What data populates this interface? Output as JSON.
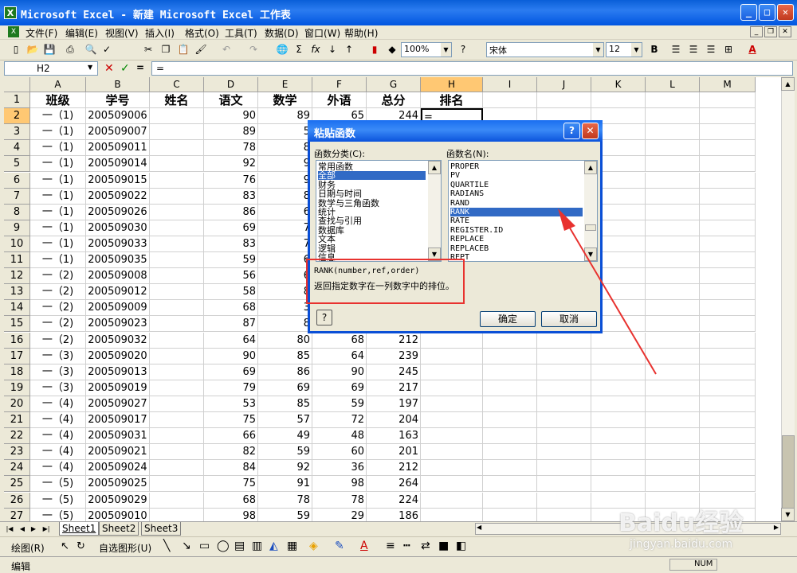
{
  "window": {
    "title": "Microsoft Excel - 新建 Microsoft Excel 工作表"
  },
  "menu": [
    "文件(F)",
    "编辑(E)",
    "视图(V)",
    "插入(I)",
    "格式(O)",
    "工具(T)",
    "数据(D)",
    "窗口(W)",
    "帮助(H)"
  ],
  "toolbar": {
    "zoom": "100%",
    "font": "宋体",
    "size": "12",
    "bold": "B",
    "font_color": "A"
  },
  "formula_bar": {
    "cell_ref": "H2",
    "eq": "=",
    "content": "="
  },
  "grid": {
    "columns": [
      "A",
      "B",
      "C",
      "D",
      "E",
      "F",
      "G",
      "H",
      "I",
      "J",
      "K",
      "L",
      "M"
    ],
    "header_row": [
      "班级",
      "学号",
      "姓名",
      "语文",
      "数学",
      "外语",
      "总分",
      "排名"
    ],
    "rows": [
      {
        "n": "1"
      },
      {
        "n": "2",
        "a": "一（1)",
        "b": "200509006",
        "d": "90",
        "e": "89",
        "f": "65",
        "g": "244",
        "h": "="
      },
      {
        "n": "3",
        "a": "一（1)",
        "b": "200509007",
        "d": "89",
        "e": "5"
      },
      {
        "n": "4",
        "a": "一（1)",
        "b": "200509011",
        "d": "78",
        "e": "8"
      },
      {
        "n": "5",
        "a": "一（1)",
        "b": "200509014",
        "d": "92",
        "e": "9"
      },
      {
        "n": "6",
        "a": "一（1)",
        "b": "200509015",
        "d": "76",
        "e": "9"
      },
      {
        "n": "7",
        "a": "一（1)",
        "b": "200509022",
        "d": "83",
        "e": "8"
      },
      {
        "n": "8",
        "a": "一（1)",
        "b": "200509026",
        "d": "86",
        "e": "6"
      },
      {
        "n": "9",
        "a": "一（1)",
        "b": "200509030",
        "d": "69",
        "e": "7"
      },
      {
        "n": "10",
        "a": "一（1)",
        "b": "200509033",
        "d": "83",
        "e": "7"
      },
      {
        "n": "11",
        "a": "一（1)",
        "b": "200509035",
        "d": "59",
        "e": "6"
      },
      {
        "n": "12",
        "a": "一（2)",
        "b": "200509008",
        "d": "56",
        "e": "6"
      },
      {
        "n": "13",
        "a": "一（2)",
        "b": "200509012",
        "d": "58",
        "e": "8"
      },
      {
        "n": "14",
        "a": "一（2)",
        "b": "200509009",
        "d": "68",
        "e": "3"
      },
      {
        "n": "15",
        "a": "一（2)",
        "b": "200509023",
        "d": "87",
        "e": "8"
      },
      {
        "n": "16",
        "a": "一（2)",
        "b": "200509032",
        "d": "64",
        "e": "80",
        "f": "68",
        "g": "212"
      },
      {
        "n": "17",
        "a": "一（3)",
        "b": "200509020",
        "d": "90",
        "e": "85",
        "f": "64",
        "g": "239"
      },
      {
        "n": "18",
        "a": "一（3)",
        "b": "200509013",
        "d": "69",
        "e": "86",
        "f": "90",
        "g": "245"
      },
      {
        "n": "19",
        "a": "一（3)",
        "b": "200509019",
        "d": "79",
        "e": "69",
        "f": "69",
        "g": "217"
      },
      {
        "n": "20",
        "a": "一（4)",
        "b": "200509027",
        "d": "53",
        "e": "85",
        "f": "59",
        "g": "197"
      },
      {
        "n": "21",
        "a": "一（4)",
        "b": "200509017",
        "d": "75",
        "e": "57",
        "f": "72",
        "g": "204"
      },
      {
        "n": "22",
        "a": "一（4)",
        "b": "200509031",
        "d": "66",
        "e": "49",
        "f": "48",
        "g": "163"
      },
      {
        "n": "23",
        "a": "一（4)",
        "b": "200509021",
        "d": "82",
        "e": "59",
        "f": "60",
        "g": "201"
      },
      {
        "n": "24",
        "a": "一（4)",
        "b": "200509024",
        "d": "84",
        "e": "92",
        "f": "36",
        "g": "212"
      },
      {
        "n": "25",
        "a": "一（5)",
        "b": "200509025",
        "d": "75",
        "e": "91",
        "f": "98",
        "g": "264"
      },
      {
        "n": "26",
        "a": "一（5)",
        "b": "200509029",
        "d": "68",
        "e": "78",
        "f": "78",
        "g": "224"
      },
      {
        "n": "27",
        "a": "一（5)",
        "b": "200509010",
        "d": "98",
        "e": "59",
        "f": "29",
        "g": "186"
      }
    ]
  },
  "sheets": [
    "Sheet1",
    "Sheet2",
    "Sheet3"
  ],
  "drawbar": {
    "draw": "绘图(R)",
    "autoshapes": "自选图形(U)"
  },
  "status": {
    "mode": "编辑",
    "num": "NUM"
  },
  "dialog": {
    "title": "粘贴函数",
    "category_label": "函数分类(C):",
    "name_label": "函数名(N):",
    "categories": [
      "常用函数",
      "全部",
      "财务",
      "日期与时间",
      "数学与三角函数",
      "统计",
      "查找与引用",
      "数据库",
      "文本",
      "逻辑",
      "信息"
    ],
    "selected_category": 1,
    "functions": [
      "PROPER",
      "PV",
      "QUARTILE",
      "RADIANS",
      "RAND",
      "RANK",
      "RATE",
      "REGISTER.ID",
      "REPLACE",
      "REPLACEB",
      "REPT"
    ],
    "selected_function": 5,
    "syntax": "RANK(number,ref,order)",
    "description": "返回指定数字在一列数字中的排位。",
    "ok": "确定",
    "cancel": "取消",
    "help": "?"
  },
  "watermark": {
    "brand": "Baidu经验",
    "url": "jingyan.baidu.com"
  },
  "colors": {
    "title_bar": "#0a5fd8",
    "highlight": "#316ac5",
    "annotation": "#e8322f"
  }
}
